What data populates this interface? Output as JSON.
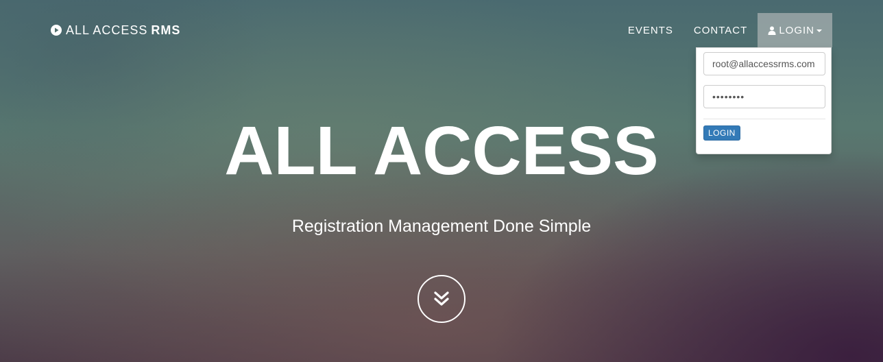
{
  "brand": {
    "icon": "play-circle-icon",
    "name_light": "ALL ACCESS",
    "name_bold": "RMS"
  },
  "nav": {
    "events_label": "EVENTS",
    "contact_label": "CONTACT",
    "login_label": "LOGIN",
    "login_icon": "user-icon"
  },
  "login_form": {
    "email_value": "root@allaccessrms.com",
    "password_value": "••••••••",
    "submit_label": "LOGIN",
    "submit_color": "#337ab7"
  },
  "hero": {
    "title": "ALL ACCESS",
    "subtitle": "Registration Management Done Simple",
    "scroll_icon": "double-chevron-down-icon"
  }
}
